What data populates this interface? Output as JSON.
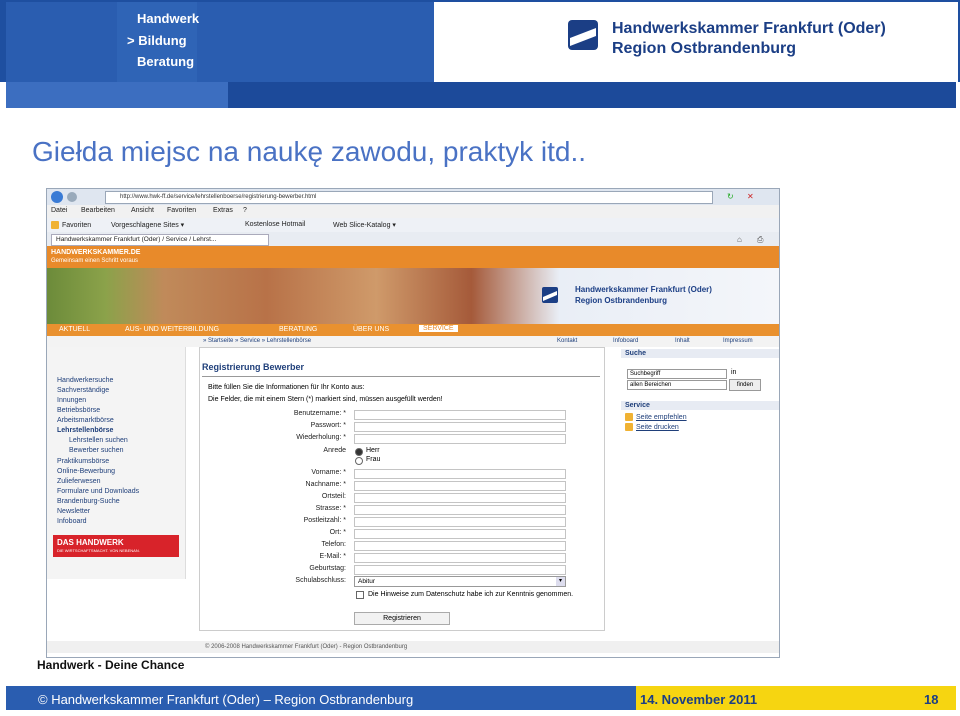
{
  "header": {
    "brand_lines": [
      "Handwerk",
      "> Bildung",
      "Beratung"
    ],
    "org_line1": "Handwerkskammer Frankfurt (Oder)",
    "org_line2": "Region Ostbrandenburg"
  },
  "slide": {
    "title": "Giełda miejsc na naukę zawodu, praktyk itd..",
    "slogan": "Handwerk - Deine Chance",
    "footer_left": "© Handwerkskammer Frankfurt (Oder) – Region Ostbrandenburg",
    "footer_date": "14. November 2011",
    "page_number": "18"
  },
  "browser": {
    "url": "http://www.hwk-ff.de/service/lehrstellenboerse/registrierung-bewerber.html",
    "menu": [
      "Datei",
      "Bearbeiten",
      "Ansicht",
      "Favoriten",
      "Extras",
      "?"
    ],
    "favorites": [
      "Favoriten",
      "Vorgeschlagene Sites ▾",
      "Kostenlose Hotmail",
      "Web Slice-Katalog ▾"
    ],
    "tab_title": "Handwerkskammer Frankfurt (Oder) / Service / Lehrst...",
    "site_brand": "HANDWERKSKAMMER.DE",
    "site_tagline": "Gemeinsam einen Schritt voraus",
    "site_org1": "Handwerkskammer Frankfurt (Oder)",
    "site_org2": "Region Ostbrandenburg",
    "nav": [
      "AKTUELL",
      "AUS- UND WEITERBILDUNG",
      "BERATUNG",
      "ÜBER UNS",
      "SERVICE"
    ],
    "subnav_left": "» Startseite » Service » Lehrstellenbörse",
    "subnav_right": [
      "Kontakt",
      "Infoboard",
      "Inhalt",
      "Impressum"
    ],
    "sidebar": [
      "Handwerkersuche",
      "Sachverständige",
      "Innungen",
      "Betriebsbörse",
      "Arbeitsmarktbörse",
      "Lehrstellenbörse",
      "Lehrstellen suchen",
      "Bewerber suchen",
      "Praktikumsbörse",
      "Online-Bewerbung",
      "Zulieferwesen",
      "Formulare und Downloads",
      "Brandenburg-Suche",
      "Newsletter",
      "Infoboard"
    ],
    "das_handwerk": "DAS HANDWERK",
    "das_handwerk_sub": "DIE WIRTSCHAFTSMACHT. VON NEBENAN.",
    "form": {
      "heading": "Registrierung Bewerber",
      "intro1": "Bitte füllen Sie die Informationen für Ihr Konto aus:",
      "intro2": "Die Felder, die mit einem Stern (*) markiert sind, müssen ausgefüllt werden!",
      "fields": [
        "Benutzername: *",
        "Passwort: *",
        "Wiederholung: *",
        "Anrede",
        "Vorname: *",
        "Nachname: *",
        "Ortsteil:",
        "Strasse: *",
        "Postleitzahl: *",
        "Ort: *",
        "Telefon:",
        "E-Mail: *",
        "Geburtstag:",
        "Schulabschluss:"
      ],
      "anrede_options": [
        "Herr",
        "Frau"
      ],
      "schulabschluss": "Abitur",
      "consent": "Die Hinweise zum Datenschutz habe ich zur Kenntnis genommen.",
      "submit": "Registrieren"
    },
    "search": {
      "heading": "Suche",
      "placeholder": "Suchbegriff",
      "in_label": "in",
      "scope": "allen Bereichen",
      "button": "finden"
    },
    "service": {
      "heading": "Service",
      "items": [
        "Seite empfehlen",
        "Seite drucken"
      ]
    },
    "footer": "© 2006-2008 Handwerkskammer Frankfurt (Oder) - Region Ostbrandenburg"
  }
}
